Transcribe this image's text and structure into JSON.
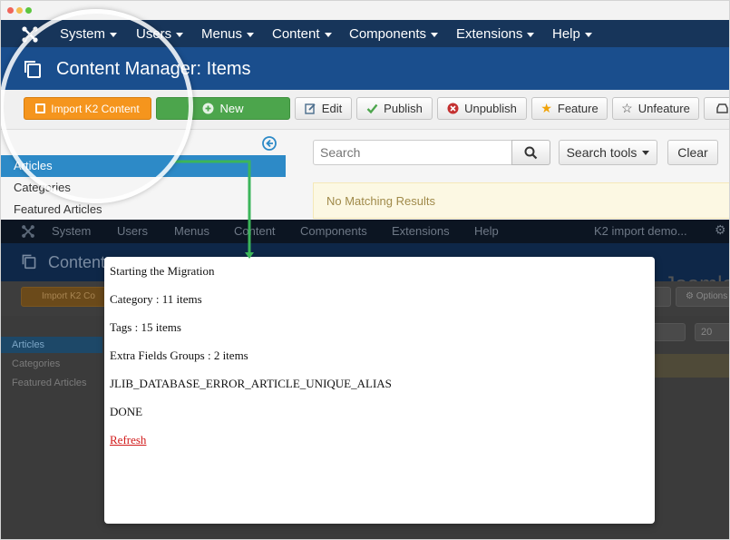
{
  "window": {
    "dots": [
      "#f0655a",
      "#f4bd4f",
      "#5cc63f"
    ]
  },
  "navbar": {
    "items": [
      {
        "label": "System"
      },
      {
        "label": "Users"
      },
      {
        "label": "Menus"
      },
      {
        "label": "Content"
      },
      {
        "label": "Components"
      },
      {
        "label": "Extensions"
      },
      {
        "label": "Help"
      }
    ]
  },
  "header": {
    "title": "Content Manager: Items"
  },
  "toolbar": {
    "import_label": "Import K2 Content",
    "new_label": "New",
    "edit_label": "Edit",
    "publish_label": "Publish",
    "unpublish_label": "Unpublish",
    "feature_label": "Feature",
    "unfeature_label": "Unfeature"
  },
  "sidebar": {
    "items": [
      {
        "label": "Articles",
        "active": true
      },
      {
        "label": "Categories",
        "active": false
      },
      {
        "label": "Featured Articles",
        "active": false
      }
    ]
  },
  "search": {
    "placeholder": "Search",
    "tools_label": "Search tools",
    "clear_label": "Clear"
  },
  "results": {
    "message": "No Matching Results"
  },
  "dark_nav": {
    "items": [
      {
        "label": "System"
      },
      {
        "label": "Users"
      },
      {
        "label": "Menus"
      },
      {
        "label": "Content"
      },
      {
        "label": "Components"
      },
      {
        "label": "Extensions"
      },
      {
        "label": "Help"
      }
    ],
    "site_label": "K2 import demo..."
  },
  "dark_header": {
    "title": "Content"
  },
  "dark_toolbar": {
    "import_label": "Import K2 Co",
    "options_label": "Options",
    "limit_value": "20"
  },
  "dark_sidebar": {
    "items": [
      {
        "label": "Articles"
      },
      {
        "label": "Categories"
      },
      {
        "label": "Featured Articles"
      }
    ]
  },
  "brand": {
    "name": "Joomla"
  },
  "modal": {
    "lines": [
      "Starting the Migration",
      "Category : 11 items",
      "Tags : 15 items",
      "Extra Fields Groups : 2 items",
      "JLIB_DATABASE_ERROR_ARTICLE_UNIQUE_ALIAS",
      "DONE"
    ],
    "refresh_label": "Refresh"
  },
  "colors": {
    "navbar": "#17355a",
    "header": "#1a4e8d",
    "accent_orange": "#f5951d",
    "accent_green": "#4ca54c",
    "sidebar_active": "#2d8ac7",
    "connector": "#3cb55a",
    "refresh_link": "#d11919"
  },
  "icons": {
    "joomla_logo": "joomla-icon",
    "copy": "copy-icon",
    "edit": "edit-icon",
    "publish": "check-icon",
    "unpublish": "x-circle-icon",
    "feature": "star-icon",
    "unfeature": "star-outline-icon",
    "search": "search-icon",
    "collapse": "circle-arrow-left-icon"
  }
}
